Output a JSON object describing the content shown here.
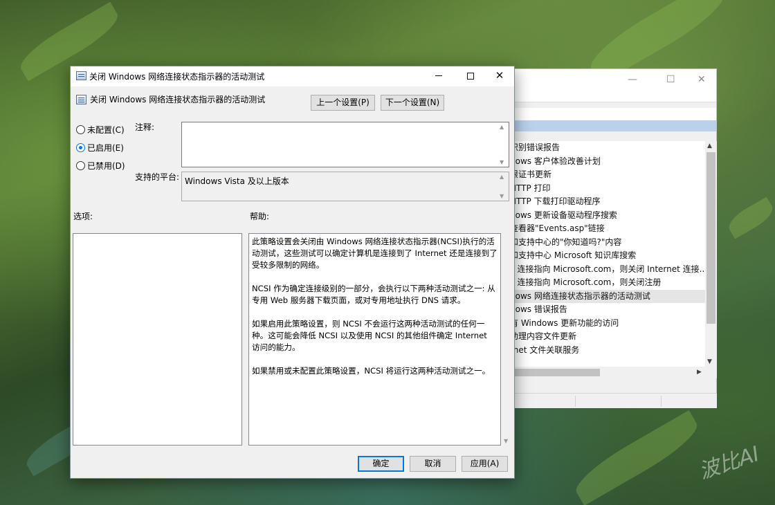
{
  "background_window": {
    "close_glyph": "✕",
    "max_glyph": "☐",
    "min_glyph": "—",
    "items": [
      "识别错误报告",
      "dows 客户体验改善计划",
      "根证书更新",
      " HTTP 打印",
      " HTTP 下载打印驱动程序",
      "dows 更新设备驱动程序搜索",
      "查看器\"Events.asp\"链接",
      "和支持中心的\"你知道吗?\"内容",
      "和支持中心 Microsoft 知识库搜索",
      "L 连接指向 Microsoft.com，则关闭 Internet 连接...",
      "L 连接指向 Microsoft.com，则关闭注册",
      "dows 网络连接状态指示器的活动测试",
      "dows 错误报告",
      "有 Windows 更新功能的访问",
      "助理内容文件更新",
      "rnet 文件关联服务"
    ],
    "selected_index": 11
  },
  "dialog": {
    "title": "关闭 Windows 网络连接状态指示器的活动测试",
    "header_title": "关闭 Windows 网络连接状态指示器的活动测试",
    "prev_button": "上一个设置(P)",
    "next_button": "下一个设置(N)",
    "radios": [
      {
        "label": "未配置(C)",
        "checked": false
      },
      {
        "label": "已启用(E)",
        "checked": true
      },
      {
        "label": "已禁用(D)",
        "checked": false
      }
    ],
    "comment_label": "注释:",
    "comment_value": "",
    "platform_label": "支持的平台:",
    "platform_value": "Windows Vista 及以上版本",
    "options_label": "选项:",
    "help_label": "帮助:",
    "help_paragraphs": [
      "此策略设置会关闭由 Windows 网络连接状态指示器(NCSI)执行的活动测试，这些测试可以确定计算机是连接到了 Internet 还是连接到了受较多限制的网络。",
      "NCSI 作为确定连接级别的一部分，会执行以下两种活动测试之一: 从专用 Web 服务器下载页面，或对专用地址执行 DNS 请求。",
      "如果启用此策略设置，则 NCSI 不会运行这两种活动测试的任何一种。这可能会降低 NCSI 以及使用 NCSI 的其他组件确定 Internet 访问的能力。",
      "如果禁用或未配置此策略设置，NCSI 将运行这两种活动测试之一。"
    ],
    "ok_button": "确定",
    "cancel_button": "取消",
    "apply_button": "应用(A)",
    "close_glyph": "✕"
  },
  "watermark": "波比AI",
  "colors": {
    "accent": "#0078d7",
    "dialog_bg": "#f0f0f0",
    "selection_strip": "#b9d1ea"
  }
}
